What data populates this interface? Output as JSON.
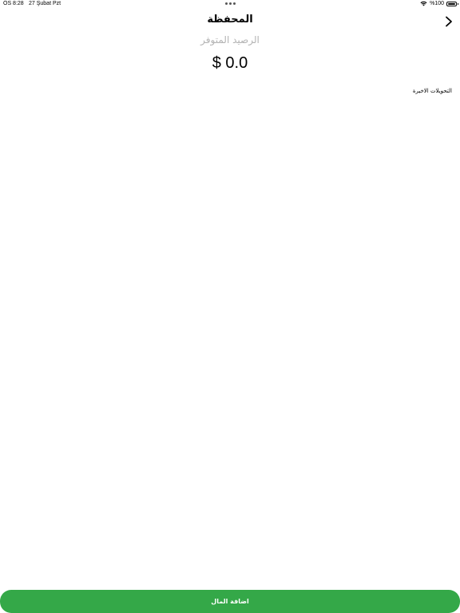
{
  "status_bar": {
    "time": "ÖS 8:28",
    "date": "27 Şubat Pzt",
    "battery": "%100",
    "icons": [
      "wifi-icon",
      "battery-icon"
    ]
  },
  "nav": {
    "title": "المحفظة",
    "back_icon": "chevron-right-icon"
  },
  "wallet": {
    "balance_label": "الرصيد المتوفر",
    "balance_amount": "$ 0.0"
  },
  "transactions": {
    "header": "التحويلات الاخيرة",
    "items": []
  },
  "footer": {
    "add_money_label": "اضافة المال",
    "button_color": "#34a848"
  }
}
